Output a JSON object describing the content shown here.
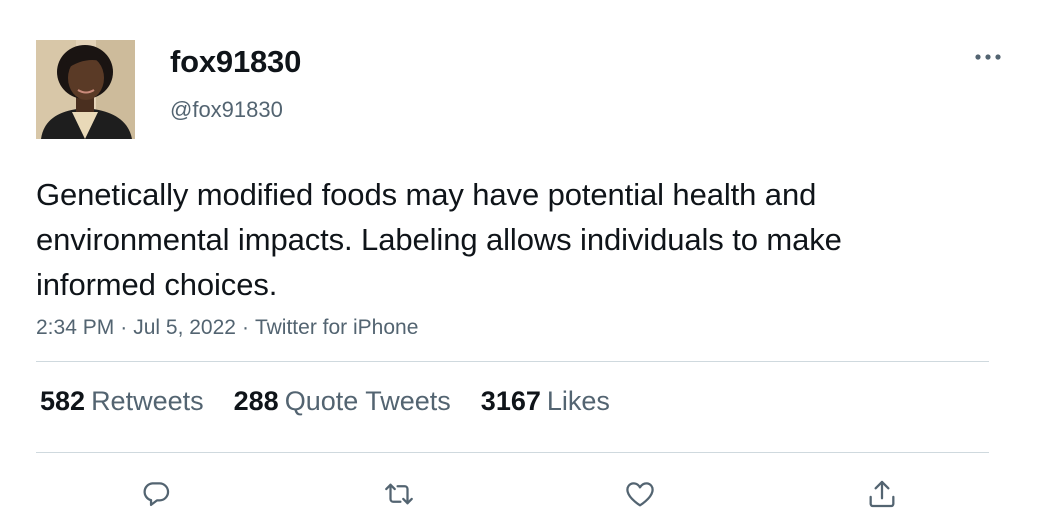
{
  "tweet": {
    "display_name": "fox91830",
    "handle": "@fox91830",
    "text": "Genetically modified foods may have potential health and environmental impacts. Labeling allows individuals to make informed choices.",
    "time": "2:34 PM",
    "date": "Jul 5, 2022",
    "source": "Twitter for iPhone",
    "separator": "·"
  },
  "stats": {
    "retweets": {
      "count": "582",
      "label": "Retweets"
    },
    "quote_tweets": {
      "count": "288",
      "label": "Quote Tweets"
    },
    "likes": {
      "count": "3167",
      "label": "Likes"
    }
  },
  "icons": {
    "more": "more-horizontal-icon",
    "reply": "reply-icon",
    "retweet": "retweet-icon",
    "like": "heart-icon",
    "share": "share-icon"
  },
  "colors": {
    "text_primary": "#0f1419",
    "text_secondary": "#536471",
    "divider": "#cfd9de"
  }
}
